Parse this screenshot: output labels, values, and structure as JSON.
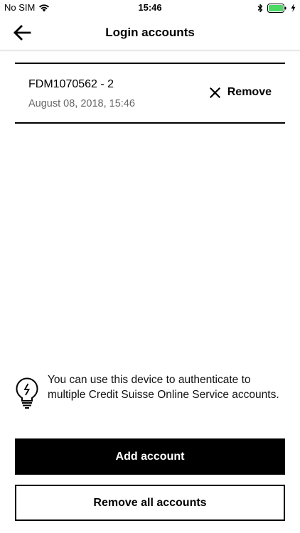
{
  "status_bar": {
    "carrier": "No SIM",
    "time": "15:46",
    "icons": [
      "wifi-icon",
      "bluetooth-icon",
      "battery-icon",
      "charging-icon"
    ]
  },
  "header": {
    "title": "Login accounts",
    "back_icon": "arrow-left-icon"
  },
  "accounts": [
    {
      "id": "FDM1070562 - 2",
      "date": "August 08, 2018, 15:46",
      "remove_label": "Remove",
      "remove_icon": "close-icon"
    }
  ],
  "info": {
    "icon": "lightbulb-icon",
    "text": "You can use this device to authenticate to multiple Credit Suisse Online Service accounts."
  },
  "actions": {
    "add_account_label": "Add account",
    "remove_all_label": "Remove all accounts"
  },
  "colors": {
    "primary": "#000000",
    "background": "#ffffff",
    "secondary_text": "#666666",
    "battery": "#4cd964"
  }
}
